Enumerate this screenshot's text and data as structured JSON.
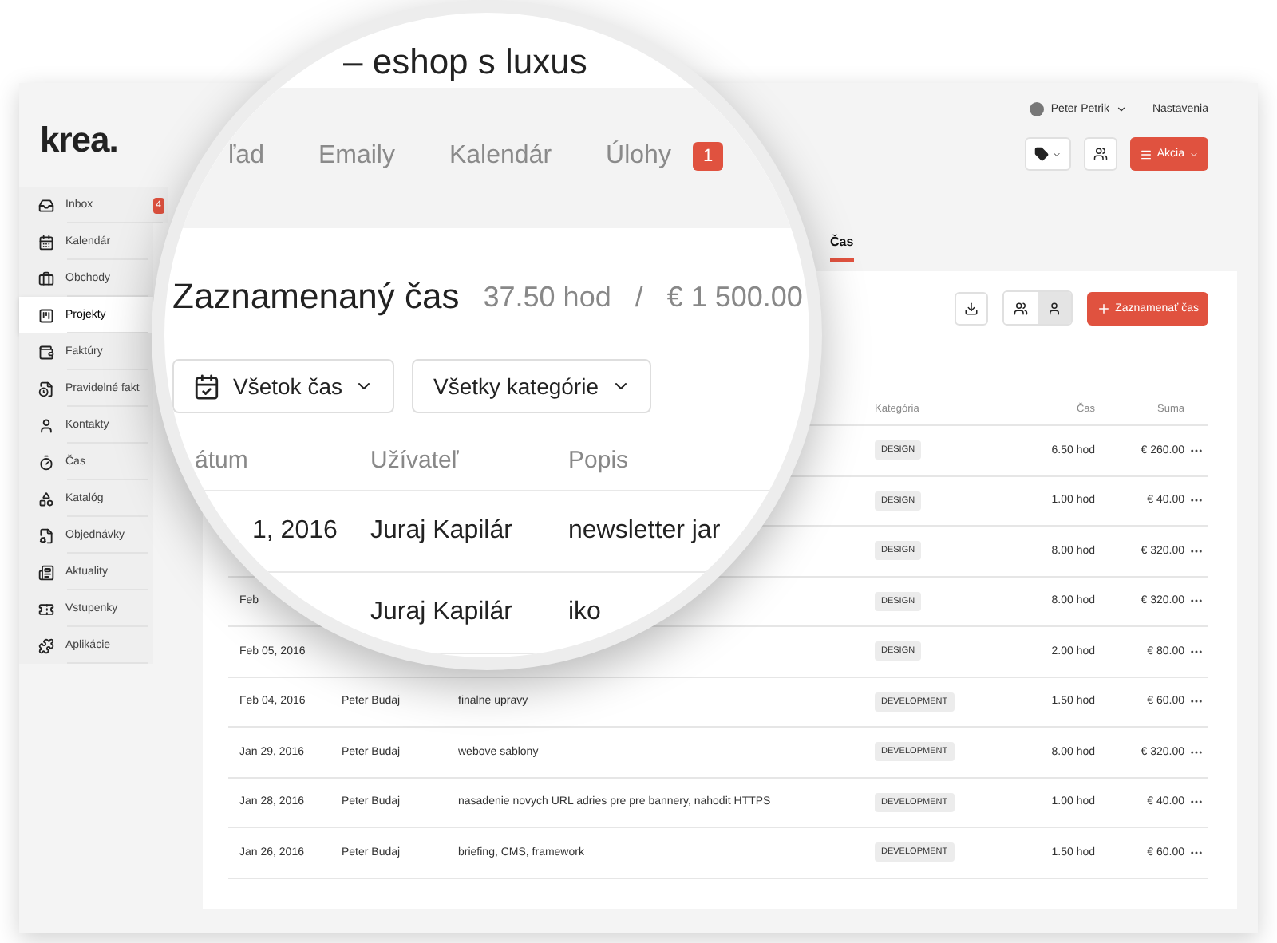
{
  "user_menu": {
    "name": "Peter Petrik",
    "settings": "Nastavenia"
  },
  "logo": "krea.",
  "sidebar": [
    {
      "label": "Inbox",
      "badge": "4",
      "selected": false
    },
    {
      "label": "Kalendár",
      "selected": false
    },
    {
      "label": "Obchody",
      "selected": false
    },
    {
      "label": "Projekty",
      "selected": true
    },
    {
      "label": "Faktúry",
      "selected": false
    },
    {
      "label": "Pravidelné fakt",
      "selected": false
    },
    {
      "label": "Kontakty",
      "selected": false
    },
    {
      "label": "Čas",
      "selected": false
    },
    {
      "label": "Katalóg",
      "selected": false
    },
    {
      "label": "Objednávky",
      "selected": false
    },
    {
      "label": "Aktuality",
      "selected": false
    },
    {
      "label": "Vstupenky",
      "selected": false
    },
    {
      "label": "Aplikácie",
      "selected": false
    }
  ],
  "header_actions": {
    "menu_label": "Akcia"
  },
  "tabs": [
    {
      "label": "Čas",
      "selected": true
    }
  ],
  "toolbar": {
    "view_toggle": [
      {
        "kind": "team",
        "selected": false
      },
      {
        "kind": "single",
        "selected": true
      }
    ],
    "add_label": "Zaznamenať čas"
  },
  "table": {
    "columns": {
      "category": "Kategória",
      "time": "Čas",
      "sum": "Suma"
    },
    "rows": [
      {
        "category": "DESIGN",
        "time": "6.50 hod",
        "sum": "€ 260.00"
      },
      {
        "category": "DESIGN",
        "time": "1.00 hod",
        "sum": "€ 40.00"
      },
      {
        "category": "DESIGN",
        "time": "8.00 hod",
        "sum": "€ 320.00"
      },
      {
        "date": "Feb",
        "category": "DESIGN",
        "time": "8.00 hod",
        "sum": "€ 320.00"
      },
      {
        "date": "Feb 05, 2016",
        "category": "DESIGN",
        "time": "2.00 hod",
        "sum": "€ 80.00"
      },
      {
        "date": "Feb 04, 2016",
        "user": "Peter Budaj",
        "description": "finalne upravy",
        "category": "DEVELOPMENT",
        "time": "1.50 hod",
        "sum": "€ 60.00"
      },
      {
        "date": "Jan 29, 2016",
        "user": "Peter Budaj",
        "description": "webove sablony",
        "category": "DEVELOPMENT",
        "time": "8.00 hod",
        "sum": "€ 320.00"
      },
      {
        "date": "Jan 28, 2016",
        "user": "Peter Budaj",
        "description": "nasadenie novych URL adries pre pre bannery, nahodit HTTPS",
        "category": "DEVELOPMENT",
        "time": "1.00 hod",
        "sum": "€ 40.00"
      },
      {
        "date": "Jan 26, 2016",
        "user": "Peter Budaj",
        "description": "briefing, CMS, framework",
        "category": "DEVELOPMENT",
        "time": "1.50 hod",
        "sum": "€ 60.00"
      }
    ]
  },
  "lens": {
    "page_title": "– eshop s luxus",
    "tabs": [
      {
        "label": "ľad",
        "selected": false
      },
      {
        "label": "Emaily",
        "selected": false
      },
      {
        "label": "Kalendár",
        "selected": false
      },
      {
        "label": "Úlohy",
        "badge": "1",
        "selected": false
      }
    ],
    "heading": "Zaznamenaný čas",
    "hours": "37.50 hod",
    "separator": "/",
    "amount": "€ 1 500.00",
    "filters": [
      {
        "kind": "date",
        "label": "Všetok čas"
      },
      {
        "kind": "plain",
        "label": "Všetky kategórie"
      }
    ],
    "columns": [
      "átum",
      "Užívateľ",
      "Popis"
    ],
    "rows": [
      {
        "date": "1, 2016",
        "user": "Juraj Kapilár",
        "description": "newsletter jar"
      },
      {
        "user": "Juraj Kapilár",
        "description": "iko"
      }
    ]
  }
}
